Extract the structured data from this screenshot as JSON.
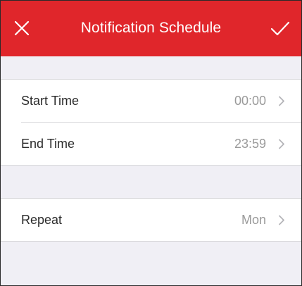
{
  "header": {
    "title": "Notification Schedule",
    "close_icon": "close-icon",
    "confirm_icon": "checkmark-icon",
    "background_color": "#e0262b"
  },
  "schedule": {
    "start_time": {
      "label": "Start Time",
      "value": "00:00"
    },
    "end_time": {
      "label": "End Time",
      "value": "23:59"
    }
  },
  "repeat": {
    "label": "Repeat",
    "value": "Mon"
  },
  "icons": {
    "row_chevron": "chevron-right-icon"
  }
}
